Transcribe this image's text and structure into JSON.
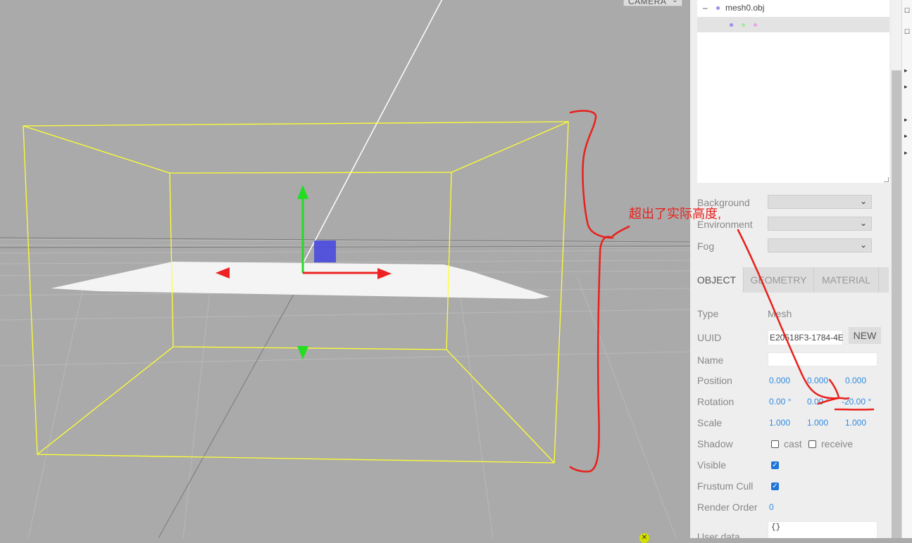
{
  "viewport": {
    "camera_select": "CAMERA",
    "colors": {
      "background": "#aaaaaa",
      "box": "#ffff33",
      "axis_y": "#22dd22",
      "axis_x": "#ff0000",
      "axis_z": "#3333cc"
    }
  },
  "outliner": {
    "opener": "–",
    "mesh_label": "mesh0.obj",
    "dot_colors": [
      "#9b8ee8",
      "#a6e7a6",
      "#e9a6e9"
    ]
  },
  "scene": {
    "background_label": "Background",
    "environment_label": "Environment",
    "fog_label": "Fog"
  },
  "tabs": [
    {
      "label": "OBJECT",
      "active": true
    },
    {
      "label": "GEOMETRY",
      "active": false
    },
    {
      "label": "MATERIAL",
      "active": false
    }
  ],
  "object": {
    "type_label": "Type",
    "type_value": "Mesh",
    "uuid_label": "UUID",
    "uuid_value": "E20518F3-1784-4E",
    "new_button": "NEW",
    "name_label": "Name",
    "name_value": "",
    "position_label": "Position",
    "position": [
      "0.000",
      "0.000",
      "0.000"
    ],
    "rotation_label": "Rotation",
    "rotation": [
      "0.00 °",
      "0.00 °",
      "-20.00 °"
    ],
    "scale_label": "Scale",
    "scale": [
      "1.000",
      "1.000",
      "1.000"
    ],
    "shadow_label": "Shadow",
    "shadow_cast_label": "cast",
    "shadow_cast": false,
    "shadow_receive_label": "receive",
    "shadow_receive": false,
    "visible_label": "Visible",
    "visible": true,
    "frustum_label": "Frustum Cull",
    "frustum": true,
    "render_order_label": "Render Order",
    "render_order": "0",
    "user_data_label": "User data",
    "user_data": "{}"
  },
  "annotation": {
    "text": "超出了实际高度,",
    "color": "#e8201c"
  }
}
